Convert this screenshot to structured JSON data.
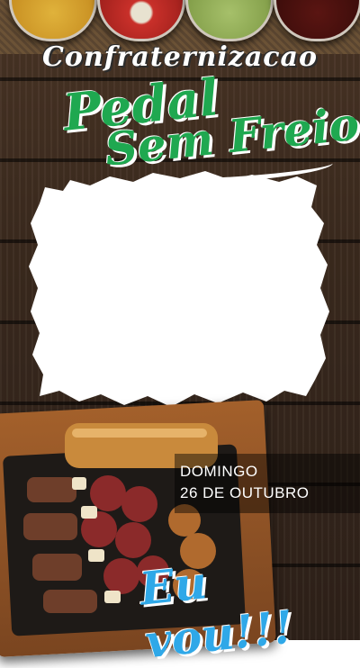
{
  "event": {
    "title_top": "Confraternizacao",
    "title_line1": "Pedal",
    "title_line2": "Sem Freio",
    "date_day": "DOMINGO",
    "date_full": "26 DE OUTUBRO",
    "cta": "Eu vou!!!"
  },
  "colors": {
    "green": "#1fa850",
    "blue": "#2fa8e8",
    "wood": "#3b2a1e"
  },
  "icons": {
    "photo_placeholder": "photo-frame-icon"
  }
}
